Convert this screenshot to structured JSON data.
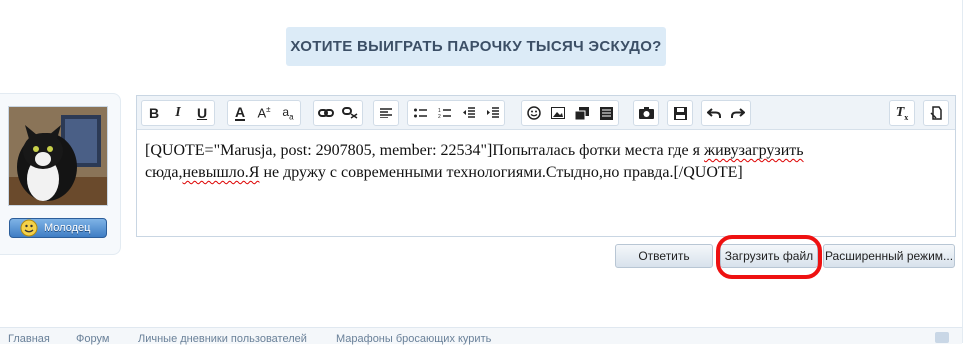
{
  "banner": {
    "text": "ХОТИТЕ ВЫИГРАТЬ ПАРОЧКУ ТЫСЯЧ ЭСКУДО?"
  },
  "user": {
    "mood_label": "Молодец"
  },
  "toolbar": {
    "icons": [
      "bold-icon",
      "italic-icon",
      "underline-icon",
      "text-color-icon",
      "font-size-icon",
      "font-family-icon",
      "link-icon",
      "unlink-icon",
      "align-icon",
      "bullet-list-icon",
      "numbered-list-icon",
      "outdent-icon",
      "indent-icon",
      "smiley-icon",
      "image-icon",
      "media-icon",
      "quote-icon",
      "camera-icon",
      "save-draft-icon",
      "undo-icon",
      "redo-icon",
      "clear-format-icon",
      "toggle-bbcode-icon"
    ]
  },
  "editor": {
    "line1_pre": "[QUOTE=\"Marusja, post: 2907805, member: 22534\"]Попыталась фотки места где я ",
    "line1_spell": "живузагрузить",
    "line2_pre": "сюда,",
    "line2_spell": "невышло.Я",
    "line2_post": " не дружу с современными технологиями.Стыдно,но правда.[/QUOTE]"
  },
  "actions": {
    "reply": "Ответить",
    "upload": "Загрузить файл",
    "advanced": "Расширенный режим..."
  },
  "breadcrumbs": [
    "Главная",
    "Форум",
    "Личные дневники пользователей",
    "Марафоны бросающих курить"
  ],
  "colors": {
    "annotation": "#ee1111",
    "banner_bg": "#dcebf7",
    "toolbar_bg": "#eef3f8"
  }
}
